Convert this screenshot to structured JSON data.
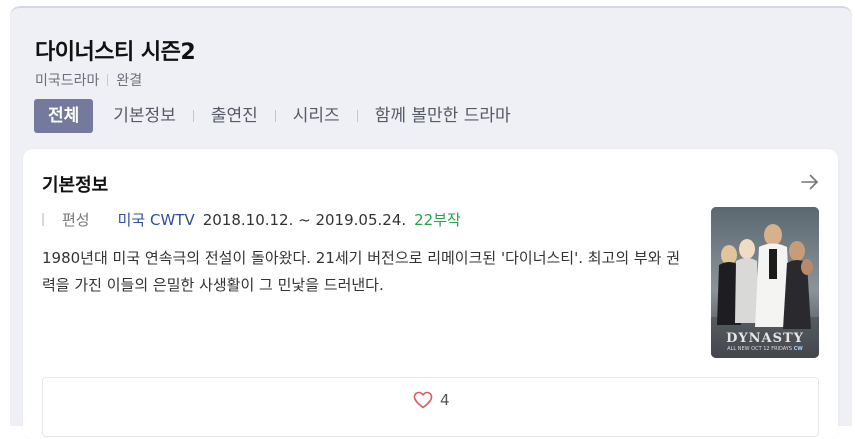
{
  "show": {
    "title": "다이너스티 시즌2",
    "genre": "미국드라마",
    "status": "완결"
  },
  "tabs": [
    {
      "label": "전체",
      "active": true
    },
    {
      "label": "기본정보",
      "active": false
    },
    {
      "label": "출연진",
      "active": false
    },
    {
      "label": "시리즈",
      "active": false
    },
    {
      "label": "함께 볼만한 드라마",
      "active": false
    }
  ],
  "info_card": {
    "title": "기본정보",
    "schedule_label": "편성",
    "channel": "미국 CWTV",
    "dates": "2018.10.12. ~ 2019.05.24.",
    "episodes": "22부작",
    "description": "1980년대 미국 연속극의 전설이 돌아왔다. 21세기 버전으로 리메이크된 '다이너스티'. 최고의 부와 권력을 가진 이들의 은밀한 사생활이 그 민낯을 드러낸다.",
    "poster_logo": "DYNASTY",
    "poster_tagline": "ALL NEW OCT 12 FRIDAYS",
    "poster_network": "CW",
    "like_count": "4"
  },
  "colors": {
    "accent_tab": "#737a9e",
    "episodes_green": "#29a24b",
    "channel_blue": "#2e4f9e",
    "heart_red": "#e05a63"
  },
  "icons": {
    "arrow": "arrow-right-icon",
    "heart": "heart-icon"
  }
}
